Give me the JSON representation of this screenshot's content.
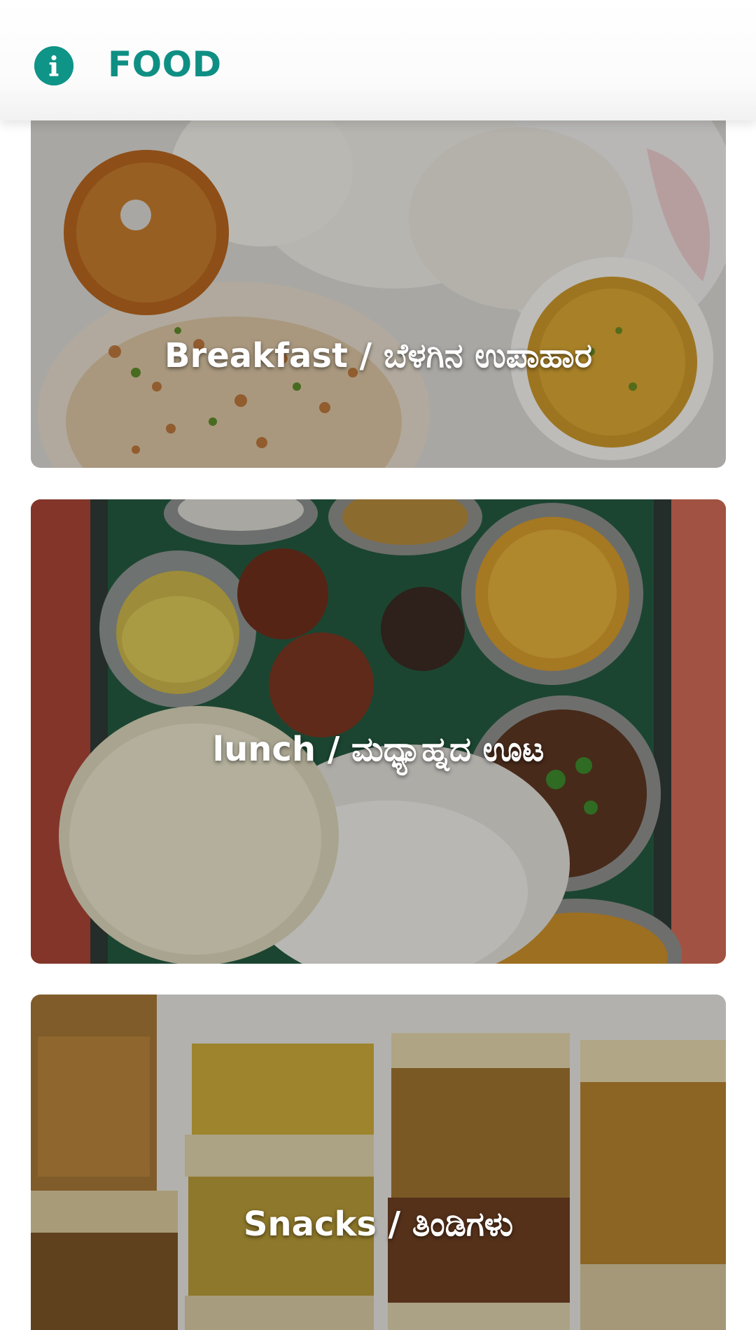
{
  "header": {
    "title": "FOOD",
    "icon": "info-icon"
  },
  "categories": [
    {
      "label": "Breakfast / ಬೆಳಗಿನ ಉಪಾಹಾರ",
      "image": "breakfast-image"
    },
    {
      "label": "lunch / ಮಧ್ಯಾಹ್ನದ ಊಟ",
      "image": "lunch-image"
    },
    {
      "label": "Snacks / ತಿಂಡಿಗಳು",
      "image": "snacks-image"
    }
  ],
  "colors": {
    "accent": "#0f9488",
    "title": "#0f8f84",
    "overlay_text": "#ffffff"
  }
}
